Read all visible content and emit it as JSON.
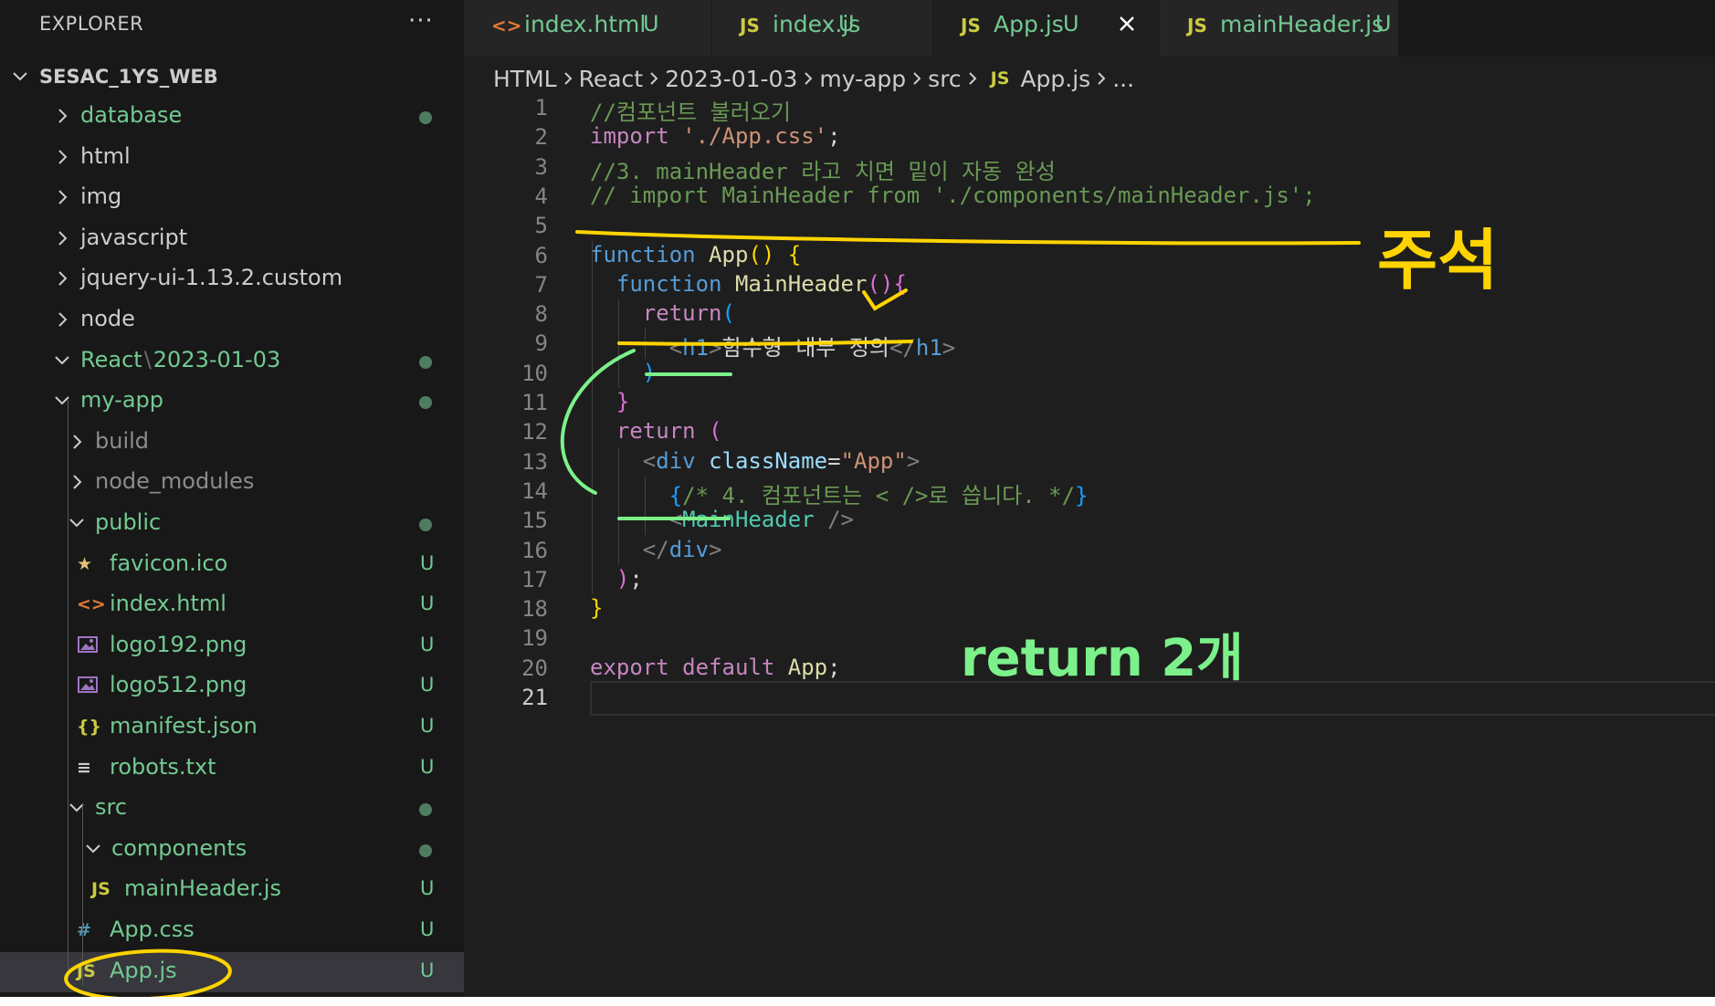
{
  "explorer": {
    "title": "EXPLORER",
    "more": "···",
    "workspace": "SESAC_1YS_WEB",
    "items": [
      {
        "label": "database",
        "type": "folder",
        "open": false,
        "depth": 0,
        "color": "#73c991",
        "status": "dot"
      },
      {
        "label": "html",
        "type": "folder",
        "open": false,
        "depth": 0,
        "color": "#cccccc",
        "status": ""
      },
      {
        "label": "img",
        "type": "folder",
        "open": false,
        "depth": 0,
        "color": "#cccccc",
        "status": ""
      },
      {
        "label": "javascript",
        "type": "folder",
        "open": false,
        "depth": 0,
        "color": "#cccccc",
        "status": ""
      },
      {
        "label": "jquery-ui-1.13.2.custom",
        "type": "folder",
        "open": false,
        "depth": 0,
        "color": "#cccccc",
        "status": ""
      },
      {
        "label": "node",
        "type": "folder",
        "open": false,
        "depth": 0,
        "color": "#cccccc",
        "status": ""
      },
      {
        "label": "React",
        "label2": "2023-01-03",
        "type": "folder",
        "open": true,
        "depth": 0,
        "color": "#73c991",
        "status": "dot"
      },
      {
        "label": "my-app",
        "type": "folder",
        "open": true,
        "depth": 1,
        "color": "#73c991",
        "status": "dot"
      },
      {
        "label": "build",
        "type": "folder",
        "open": false,
        "depth": 2,
        "color": "#8c8c8c",
        "status": ""
      },
      {
        "label": "node_modules",
        "type": "folder",
        "open": false,
        "depth": 2,
        "color": "#8c8c8c",
        "status": ""
      },
      {
        "label": "public",
        "type": "folder",
        "open": true,
        "depth": 2,
        "color": "#73c991",
        "status": "dot"
      },
      {
        "label": "favicon.ico",
        "type": "file",
        "icon": "★",
        "icon_name": "star-icon",
        "icon_color": "#e5c07b",
        "depth": 3,
        "color": "#73c991",
        "status": "U"
      },
      {
        "label": "index.html",
        "type": "file",
        "icon": "<>",
        "icon_name": "html-file-icon",
        "icon_color": "#e37933",
        "depth": 3,
        "color": "#73c991",
        "status": "U"
      },
      {
        "label": "logo192.png",
        "type": "file",
        "icon": "img",
        "icon_name": "image-file-icon",
        "icon_color": "#a074c4",
        "depth": 3,
        "color": "#73c991",
        "status": "U"
      },
      {
        "label": "logo512.png",
        "type": "file",
        "icon": "img",
        "icon_name": "image-file-icon",
        "icon_color": "#a074c4",
        "depth": 3,
        "color": "#73c991",
        "status": "U"
      },
      {
        "label": "manifest.json",
        "type": "file",
        "icon": "{}",
        "icon_name": "json-file-icon",
        "icon_color": "#cbcb41",
        "depth": 3,
        "color": "#73c991",
        "status": "U"
      },
      {
        "label": "robots.txt",
        "type": "file",
        "icon": "≡",
        "icon_name": "text-file-icon",
        "icon_color": "#cccccc",
        "depth": 3,
        "color": "#73c991",
        "status": "U"
      },
      {
        "label": "src",
        "type": "folder",
        "open": true,
        "depth": 2,
        "color": "#73c991",
        "status": "dot"
      },
      {
        "label": "components",
        "type": "folder",
        "open": true,
        "depth": 3,
        "color": "#73c991",
        "status": "dot"
      },
      {
        "label": "mainHeader.js",
        "type": "file",
        "icon": "JS",
        "icon_name": "js-file-icon",
        "icon_color": "#cbcb41",
        "depth": 4,
        "color": "#73c991",
        "status": "U"
      },
      {
        "label": "App.css",
        "type": "file",
        "icon": "#",
        "icon_name": "css-file-icon",
        "icon_color": "#519aba",
        "depth": 3,
        "color": "#73c991",
        "status": "U"
      },
      {
        "label": "App.js",
        "type": "file",
        "icon": "JS",
        "icon_name": "js-file-icon",
        "icon_color": "#cbcb41",
        "depth": 3,
        "color": "#73c991",
        "status": "U",
        "selected": true
      }
    ]
  },
  "tabs": [
    {
      "icon": "<>",
      "icon_name": "html-file-icon",
      "icon_color": "#e37933",
      "name": "index.html",
      "badge": "U",
      "active": false
    },
    {
      "icon": "JS",
      "icon_name": "js-file-icon",
      "icon_color": "#cbcb41",
      "name": "index.js",
      "badge": "U",
      "active": false
    },
    {
      "icon": "JS",
      "icon_name": "js-file-icon",
      "icon_color": "#cbcb41",
      "name": "App.js",
      "badge": "U",
      "active": true
    },
    {
      "icon": "JS",
      "icon_name": "js-file-icon",
      "icon_color": "#cbcb41",
      "name": "mainHeader.js",
      "badge": "U",
      "active": false
    }
  ],
  "breadcrumb": [
    "HTML",
    "React",
    "2023-01-03",
    "my-app",
    "src",
    "App.js",
    "..."
  ],
  "breadcrumb_file_icon": "JS",
  "colors": {
    "comment": "#6a9955",
    "keyword": "#c586c0",
    "storage": "#569cd6",
    "function": "#dcdcaa",
    "string": "#ce9178",
    "punct": "#d4d4d4",
    "tag": "#569cd6",
    "attr": "#9cdcfe",
    "component": "#4ec9b0",
    "bracket1": "#ffd700",
    "bracket2": "#da70d6",
    "bracket3": "#179fff",
    "tagpunct": "#808080",
    "text": "#d4d4d4"
  },
  "code": [
    [
      [
        "comment",
        "//컴포넌트 불러오기"
      ]
    ],
    [
      [
        "keyword",
        "import"
      ],
      [
        "text",
        " "
      ],
      [
        "string",
        "'./App.css'"
      ],
      [
        "punct",
        ";"
      ]
    ],
    [
      [
        "comment",
        "//3. mainHeader 라고 치면 밑이 자동 완성"
      ]
    ],
    [
      [
        "comment",
        "// import MainHeader from './components/mainHeader.js';"
      ]
    ],
    [],
    [
      [
        "storage",
        "function"
      ],
      [
        "text",
        " "
      ],
      [
        "function",
        "App"
      ],
      [
        "bracket1",
        "()"
      ],
      [
        "text",
        " "
      ],
      [
        "bracket1",
        "{"
      ]
    ],
    [
      [
        "text",
        "  "
      ],
      [
        "storage",
        "function"
      ],
      [
        "text",
        " "
      ],
      [
        "function",
        "MainHeader"
      ],
      [
        "bracket2",
        "()"
      ],
      [
        "bracket2",
        "{"
      ]
    ],
    [
      [
        "text",
        "    "
      ],
      [
        "keyword",
        "return"
      ],
      [
        "bracket3",
        "("
      ]
    ],
    [
      [
        "text",
        "      "
      ],
      [
        "tagpunct",
        "<"
      ],
      [
        "tag",
        "h1"
      ],
      [
        "tagpunct",
        ">"
      ],
      [
        "text",
        "함수형 내부 정의"
      ],
      [
        "tagpunct",
        "</"
      ],
      [
        "tag",
        "h1"
      ],
      [
        "tagpunct",
        ">"
      ]
    ],
    [
      [
        "text",
        "    "
      ],
      [
        "bracket3",
        ")"
      ]
    ],
    [
      [
        "text",
        "  "
      ],
      [
        "bracket2",
        "}"
      ]
    ],
    [
      [
        "text",
        "  "
      ],
      [
        "keyword",
        "return"
      ],
      [
        "text",
        " "
      ],
      [
        "bracket2",
        "("
      ]
    ],
    [
      [
        "text",
        "    "
      ],
      [
        "tagpunct",
        "<"
      ],
      [
        "tag",
        "div"
      ],
      [
        "text",
        " "
      ],
      [
        "attr",
        "className"
      ],
      [
        "punct",
        "="
      ],
      [
        "string",
        "\"App\""
      ],
      [
        "tagpunct",
        ">"
      ]
    ],
    [
      [
        "text",
        "      "
      ],
      [
        "bracket3",
        "{"
      ],
      [
        "comment",
        "/* 4. 컴포넌트는 < />로 씁니다. */"
      ],
      [
        "bracket3",
        "}"
      ]
    ],
    [
      [
        "text",
        "      "
      ],
      [
        "tagpunct",
        "<"
      ],
      [
        "component",
        "MainHeader"
      ],
      [
        "text",
        " "
      ],
      [
        "tagpunct",
        "/>"
      ]
    ],
    [
      [
        "text",
        "    "
      ],
      [
        "tagpunct",
        "</"
      ],
      [
        "tag",
        "div"
      ],
      [
        "tagpunct",
        ">"
      ]
    ],
    [
      [
        "text",
        "  "
      ],
      [
        "bracket2",
        ")"
      ],
      [
        "punct",
        ";"
      ]
    ],
    [
      [
        "bracket1",
        "}"
      ]
    ],
    [],
    [
      [
        "keyword",
        "export"
      ],
      [
        "text",
        " "
      ],
      [
        "keyword",
        "default"
      ],
      [
        "text",
        " "
      ],
      [
        "function",
        "App"
      ],
      [
        "punct",
        ";"
      ]
    ],
    []
  ],
  "current_line": 21,
  "annotations": {
    "comment_note": "주석",
    "return_note": "return 2개",
    "yellow": "#ffd400",
    "green": "#7cf08a"
  }
}
